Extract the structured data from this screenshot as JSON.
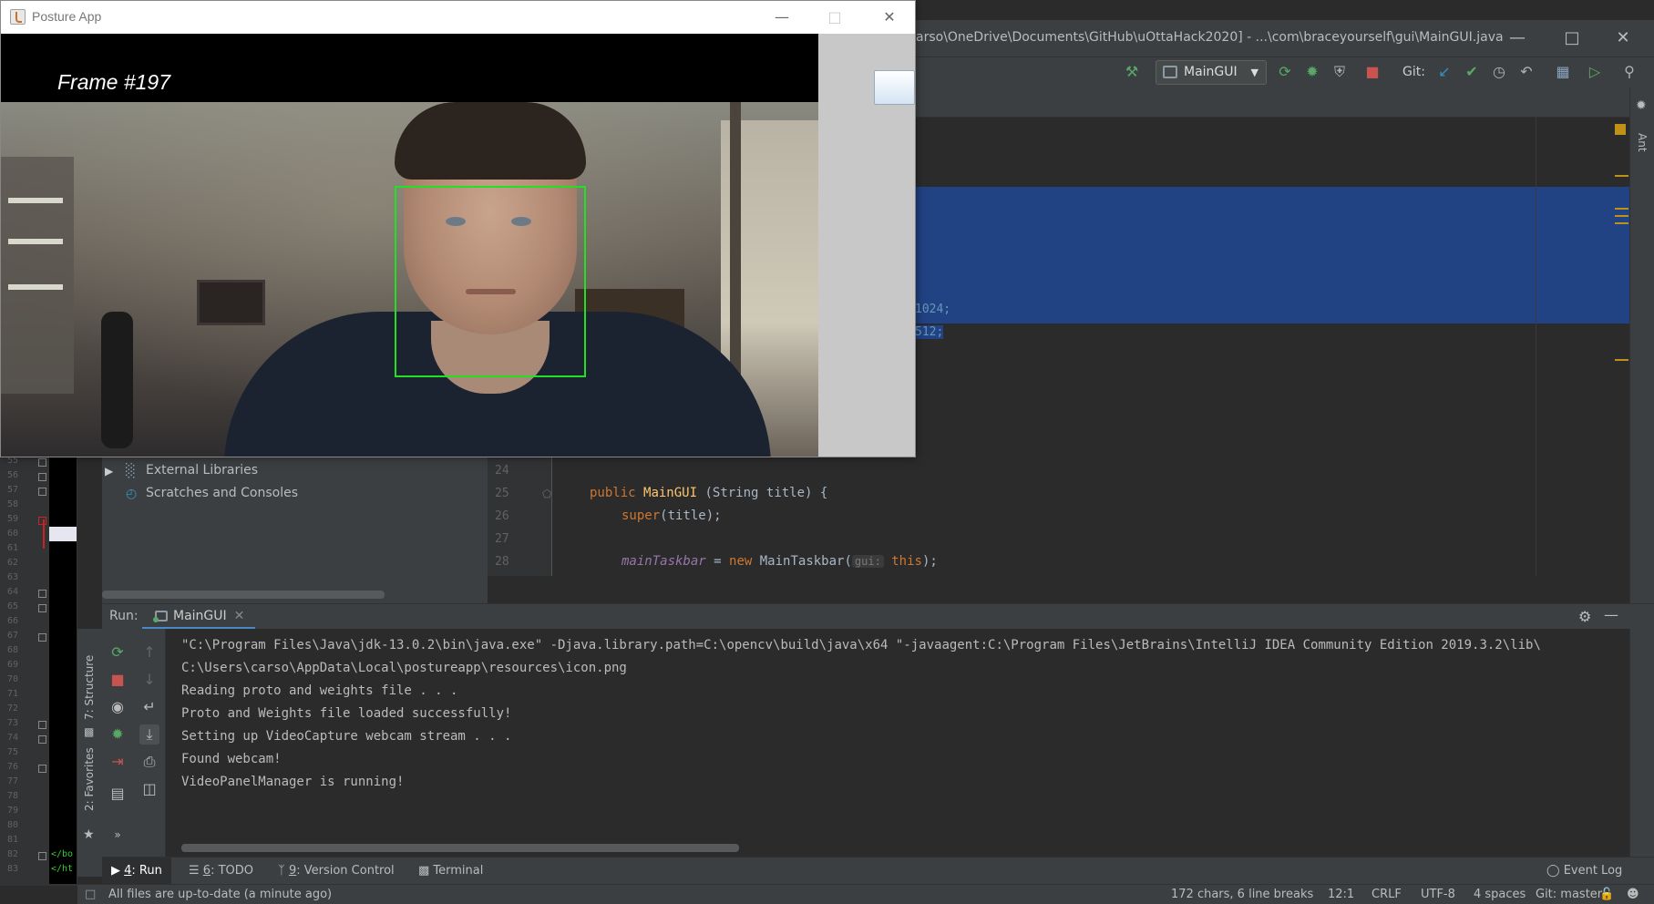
{
  "ide": {
    "title_path": "arso\\OneDrive\\Documents\\GitHub\\uOttaHack2020] - ...\\com\\braceyourself\\gui\\MainGUI.java",
    "run_config": "MainGUI",
    "git_label": "Git:",
    "right_tool_label": "Ant",
    "selected_code": [
      "1024;",
      "512;"
    ],
    "left_gutter_lines": [
      "55",
      "56",
      "57",
      "58",
      "59",
      "60",
      "61",
      "62",
      "63",
      "64",
      "65",
      "66",
      "67",
      "68",
      "69",
      "70",
      "71",
      "72",
      "73",
      "74",
      "75",
      "76",
      "77",
      "78",
      "79",
      "80",
      "81",
      "82",
      "83"
    ],
    "left_gutter_tags": [
      "</bo",
      "</ht"
    ],
    "project_tree": [
      {
        "label": "External Libraries"
      },
      {
        "label": "Scratches and Consoles"
      }
    ],
    "code": {
      "line_numbers": [
        "24",
        "25",
        "26",
        "27",
        "28"
      ],
      "line25": {
        "kw": "public",
        "fn": "MainGUI",
        "rest": " (String title) {"
      },
      "line26": {
        "kw": "super",
        "rest": "(title);"
      },
      "line28": {
        "field": "mainTaskbar",
        "mid": " = ",
        "kw": "new",
        "cls": " MainTaskbar(",
        "hint": "gui:",
        "this_kw": " this",
        "end": ");"
      }
    },
    "run_panel": {
      "label": "Run:",
      "tab": "MainGUI",
      "console": [
        "\"C:\\Program Files\\Java\\jdk-13.0.2\\bin\\java.exe\" -Djava.library.path=C:\\opencv\\build\\java\\x64 \"-javaagent:C:\\Program Files\\JetBrains\\IntelliJ IDEA Community Edition 2019.3.2\\lib\\",
        "C:\\Users\\carso\\AppData\\Local\\postureapp\\resources\\icon.png",
        "Reading proto and weights file . . .",
        "Proto and Weights file loaded successfully!",
        "Setting up VideoCapture webcam stream . . .",
        "Found webcam!",
        "VideoPanelManager is running!"
      ]
    },
    "side_tools": {
      "structure": "7: Structure",
      "favorites": "2: Favorites"
    },
    "bottom_tabs": {
      "run": {
        "num": "4",
        "label": ": Run"
      },
      "todo": {
        "num": "6",
        "label": ": TODO"
      },
      "vcs": {
        "num": "9",
        "label": ": Version Control"
      },
      "terminal": "Terminal",
      "event_log": "Event Log"
    },
    "status": {
      "message": "All files are up-to-date (a minute ago)",
      "chars": "172 chars, 6 line breaks",
      "position": "12:1",
      "line_sep": "CRLF",
      "encoding": "UTF-8",
      "indent": "4 spaces",
      "git_branch": "Git: master"
    }
  },
  "posture_app": {
    "title": "Posture App",
    "frame_label": "Frame #197",
    "face_box_color": "#22e022"
  }
}
